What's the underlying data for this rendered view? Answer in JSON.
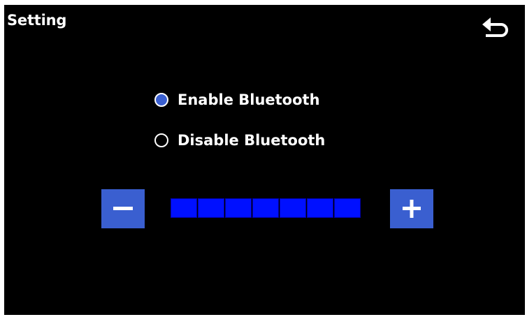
{
  "header": {
    "title": "Setting",
    "back_icon": "back-arrow-icon"
  },
  "bluetooth": {
    "options": [
      {
        "label": "Enable Bluetooth",
        "selected": true
      },
      {
        "label": "Disable Bluetooth",
        "selected": false
      }
    ]
  },
  "volume": {
    "minus_icon": "minus-icon",
    "plus_icon": "plus-icon",
    "total_segments": 7,
    "filled_segments": 7
  },
  "colors": {
    "background": "#000000",
    "accent": "#3a5fd0",
    "bar_fill": "#0010ff",
    "text": "#ffffff"
  }
}
